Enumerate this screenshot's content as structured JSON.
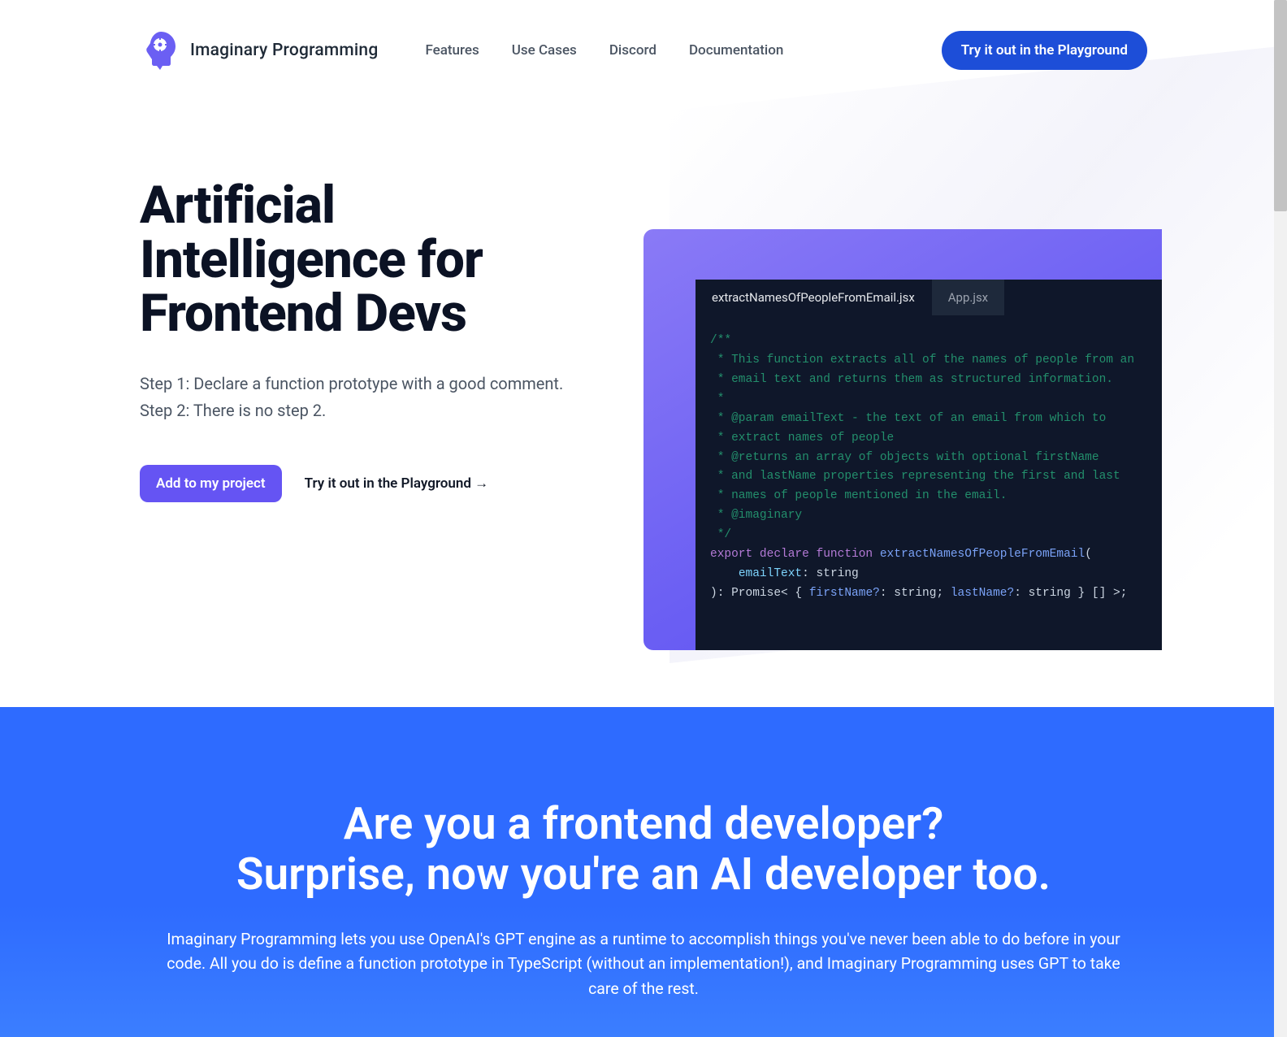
{
  "brand": {
    "name": "Imaginary Programming"
  },
  "nav": {
    "links": [
      {
        "label": "Features"
      },
      {
        "label": "Use Cases"
      },
      {
        "label": "Discord"
      },
      {
        "label": "Documentation"
      }
    ],
    "cta": "Try it out in the Playground"
  },
  "hero": {
    "title": "Artificial Intelligence for Frontend Devs",
    "step1": "Step 1: Declare a function prototype with a good comment.",
    "step2": "Step 2: There is no step 2.",
    "primary": "Add to my project",
    "secondary": "Try it out in the Playground →"
  },
  "code": {
    "tabs": [
      {
        "label": "extractNamesOfPeopleFromEmail.jsx",
        "active": true
      },
      {
        "label": "App.jsx",
        "active": false
      }
    ],
    "comment_lines": [
      "/**",
      " * This function extracts all of the names of people from an",
      " * email text and returns them as structured information.",
      " *",
      " * @param emailText - the text of an email from which to",
      " * extract names of people",
      " * @returns an array of objects with optional firstName",
      " * and lastName properties representing the first and last",
      " * names of people mentioned in the email.",
      " * @imaginary",
      " */"
    ],
    "sig": {
      "kw": "export declare function ",
      "fn": "extractNamesOfPeopleFromEmail",
      "open": "(",
      "param_name": "emailText",
      "param_rest": ": string",
      "close": "): ",
      "ret_prefix": "Promise< { ",
      "prop1": "firstName?",
      "mid1": ": string; ",
      "prop2": "lastName?",
      "mid2": ": string } [] >;"
    }
  },
  "band": {
    "title_line1": "Are you a frontend developer?",
    "title_line2": "Surprise, now you're an AI developer too.",
    "body": "Imaginary Programming lets you use OpenAI's GPT engine as a runtime to accomplish things you've never been able to do before in your code. All you do is define a function prototype in TypeScript (without an implementation!), and Imaginary Programming uses GPT to take care of the rest."
  }
}
